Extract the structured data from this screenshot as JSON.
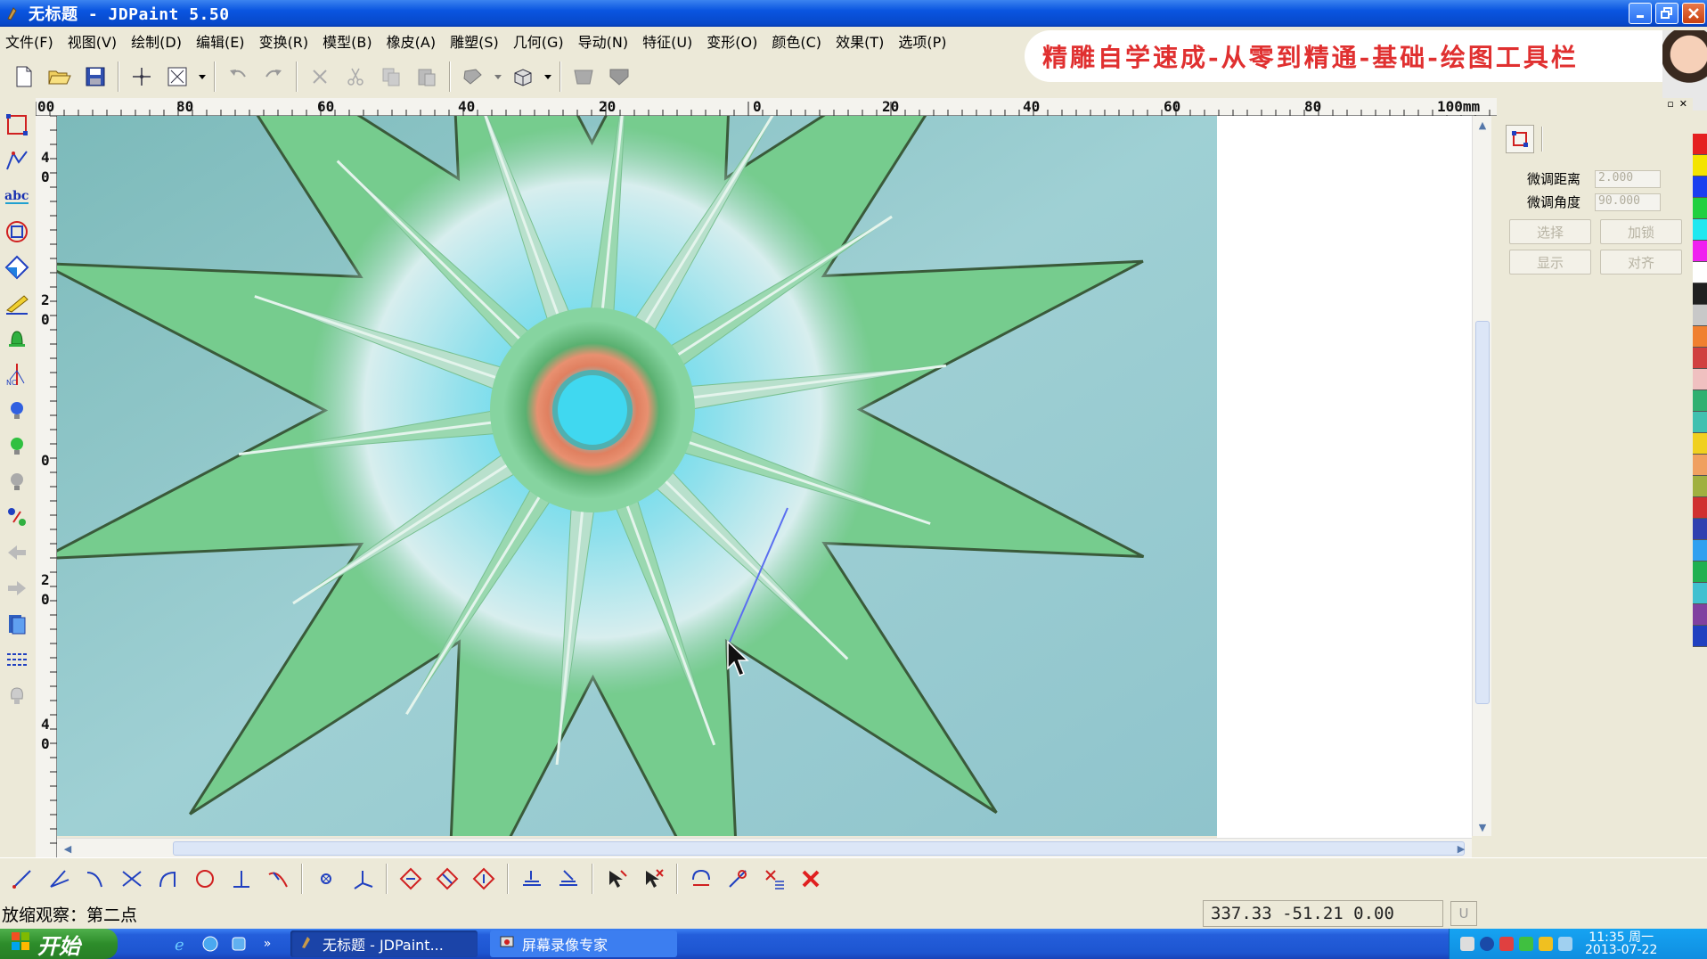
{
  "window": {
    "title": "无标题 - JDPaint 5.50"
  },
  "menu": [
    {
      "label": "文件(F)"
    },
    {
      "label": "视图(V)"
    },
    {
      "label": "绘制(D)"
    },
    {
      "label": "编辑(E)"
    },
    {
      "label": "变换(R)"
    },
    {
      "label": "模型(B)"
    },
    {
      "label": "橡皮(A)"
    },
    {
      "label": "雕塑(S)"
    },
    {
      "label": "几何(G)"
    },
    {
      "label": "导动(N)"
    },
    {
      "label": "特征(U)"
    },
    {
      "label": "变形(O)"
    },
    {
      "label": "颜色(C)"
    },
    {
      "label": "效果(T)"
    },
    {
      "label": "选项(P)"
    }
  ],
  "banner": {
    "text": "精雕自学速成-从零到精通-基础-绘图工具栏"
  },
  "toolbar": {
    "icons": [
      "new-file-icon",
      "open-folder-icon",
      "save-icon",
      "crosshair-icon",
      "select-box-icon",
      "dropdown-icon",
      "undo-icon",
      "redo-icon",
      "delete-icon",
      "cut-icon",
      "copy-icon",
      "paste-icon",
      "layer-icon",
      "view-cube-icon",
      "group-icon",
      "ungroup-icon"
    ]
  },
  "ruler": {
    "h_labels": [
      "00",
      "80",
      "60",
      "40",
      "20",
      "0",
      "20",
      "40",
      "60",
      "80",
      "100mm"
    ],
    "v_labels": [
      "4\n0",
      "2\n0",
      "0",
      "2\n0",
      "4\n0"
    ]
  },
  "left_tools": [
    "node-edit-icon",
    "polyline-icon",
    "text-abc-icon",
    "shape-icon",
    "diamond-icon",
    "sculpt-brush-icon",
    "bell-icon",
    "vector-icon",
    "bulb-blue-icon",
    "bulb-green-icon",
    "bulb-gray-icon",
    "transform-icon",
    "arrow-left-icon",
    "arrow-right-icon",
    "book-icon",
    "lines-icon",
    "lamp-icon"
  ],
  "right_panel": {
    "fine_distance_label": "微调距离",
    "fine_distance_value": "2.000",
    "fine_angle_label": "微调角度",
    "fine_angle_value": "90.000",
    "btn_select": "选择",
    "btn_lock": "加锁",
    "btn_show": "显示",
    "btn_align": "对齐"
  },
  "palette": [
    "#e52020",
    "#f4e400",
    "#1a3ff0",
    "#20d040",
    "#20e8f0",
    "#f020f0",
    "#ffffff",
    "#202020",
    "#c8c8c8",
    "#f08030",
    "#d04040",
    "#f0c0c0",
    "#30b070",
    "#40c0b0",
    "#f0d020",
    "#f0a060",
    "#a0b040",
    "#d03030",
    "#3040b0",
    "#30a0f0",
    "#20b050",
    "#40c0d0",
    "#8040a0",
    "#2040c0"
  ],
  "bottom_tools": [
    "line-icon",
    "angle-line-icon",
    "tangent-icon",
    "intersect-icon",
    "arc-icon",
    "circle-icon",
    "perpendicular-icon",
    "curve-icon",
    "node-icon",
    "axis-icon",
    "diamond-a-icon",
    "diamond-b-icon",
    "diamond-c-icon",
    "stack-a-icon",
    "stack-b-icon",
    "pick-icon",
    "pick-x-icon",
    "rotate-icon",
    "mirror-icon",
    "array-icon",
    "close-red-icon"
  ],
  "status": {
    "message": "放缩观察：第二点",
    "coords": "337.33  -51.21  0.00",
    "unit": "U"
  },
  "taskbar": {
    "start_label": "开始",
    "tasks": [
      {
        "label": "无标题 - JDPaint..."
      },
      {
        "label": "屏幕录像专家"
      }
    ],
    "clock_time": "11:35 周一",
    "clock_date": "2013-07-22"
  }
}
